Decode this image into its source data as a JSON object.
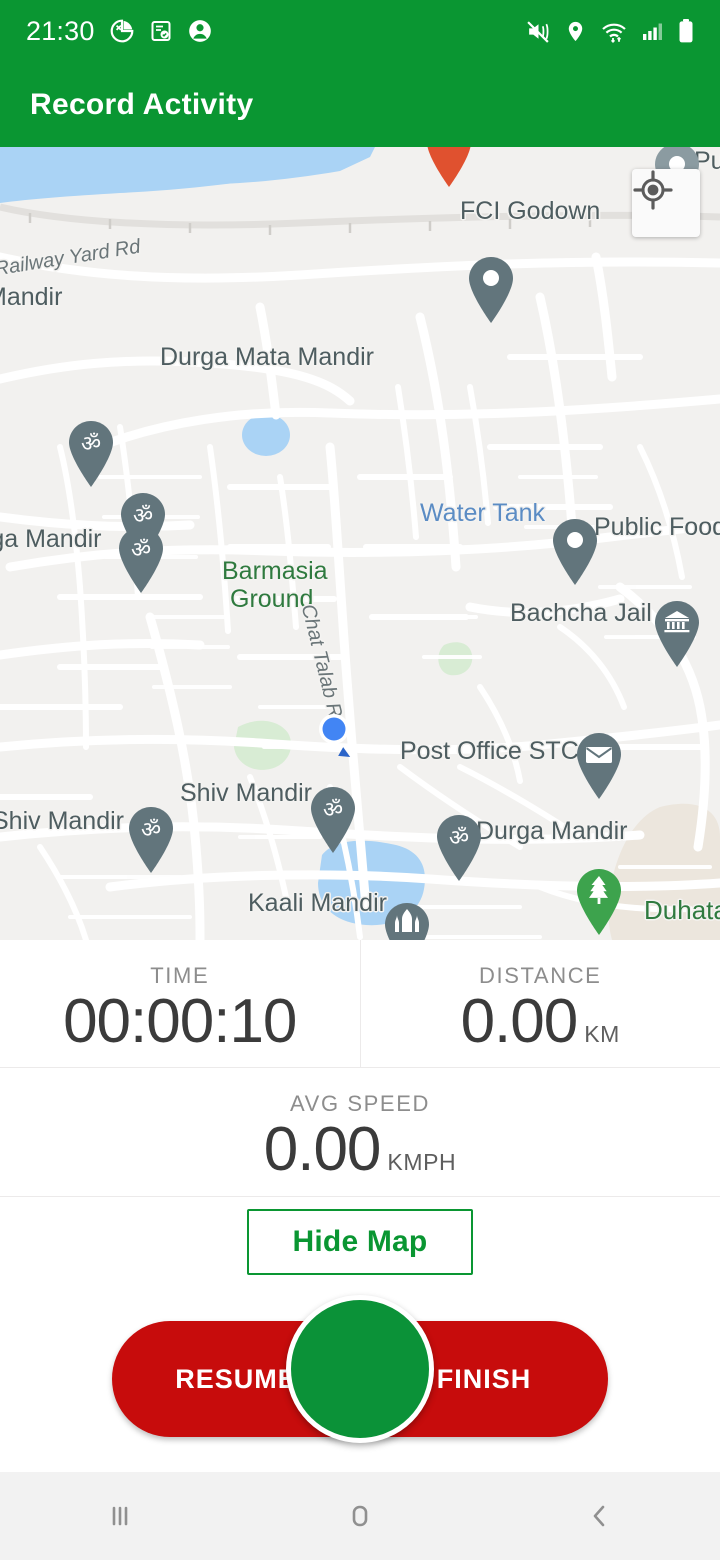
{
  "statusbar": {
    "time": "21:30",
    "left_icons": [
      "stats-pie-icon",
      "note-check-icon",
      "account-circle-icon"
    ],
    "right_icons": [
      "mute-vibrate-icon",
      "location-icon",
      "wifi-icon",
      "signal-icon",
      "battery-icon"
    ]
  },
  "appbar": {
    "title": "Record Activity"
  },
  "map": {
    "my_location_button": "my-location-icon",
    "labels": [
      {
        "text": "Railway Yard Rd",
        "kind": "road"
      },
      {
        "text": "Mandir",
        "kind": "poi"
      },
      {
        "text": "Durga Mata Mandir",
        "kind": "poi"
      },
      {
        "text": "FCI Godown",
        "kind": "poi"
      },
      {
        "text": "Pu",
        "kind": "poi"
      },
      {
        "text": "rga Mandir",
        "kind": "poi"
      },
      {
        "text": "Water Tank",
        "kind": "water"
      },
      {
        "text": "Public Food",
        "kind": "poi"
      },
      {
        "text": "Barmasia",
        "kind": "park"
      },
      {
        "text": "Ground",
        "kind": "park"
      },
      {
        "text": "Bachcha Jail",
        "kind": "poi"
      },
      {
        "text": "Chat Talab Rd",
        "kind": "road"
      },
      {
        "text": "Post Office STC",
        "kind": "poi"
      },
      {
        "text": "Shiv Mandir",
        "kind": "poi"
      },
      {
        "text": "Shiv Mandir",
        "kind": "poi"
      },
      {
        "text": "Durga Mandir",
        "kind": "poi"
      },
      {
        "text": "Kaali Mandir",
        "kind": "poi"
      },
      {
        "text": "Duhata",
        "kind": "green"
      }
    ],
    "markers": [
      {
        "name": "om-temple-pin",
        "label": "Mandir"
      },
      {
        "name": "om-temple-pin",
        "label": "Durga Mata Mandir"
      },
      {
        "name": "om-temple-pin",
        "label": "rga Mandir"
      },
      {
        "name": "om-temple-pin",
        "label": "Shiv Mandir"
      },
      {
        "name": "om-temple-pin",
        "label": "Shiv Mandir"
      },
      {
        "name": "om-temple-pin",
        "label": "Durga Mandir"
      },
      {
        "name": "generic-dot-pin",
        "label": ""
      },
      {
        "name": "generic-dot-pin",
        "label": "Public Food"
      },
      {
        "name": "generic-dot-pin",
        "label": "Pu"
      },
      {
        "name": "museum-pin",
        "label": "Bachcha Jail"
      },
      {
        "name": "post-office-pin",
        "label": "Post Office STC"
      },
      {
        "name": "temple-building-pin",
        "label": "Kaali Mandir"
      },
      {
        "name": "park-tree-pin",
        "label": "Duhata"
      },
      {
        "name": "red-destination-pin",
        "label": ""
      }
    ],
    "user_location": "user-location-dot"
  },
  "stats": {
    "time": {
      "label": "TIME",
      "value": "00:00:10",
      "unit": ""
    },
    "distance": {
      "label": "DISTANCE",
      "value": "0.00",
      "unit": "KM"
    },
    "avg_speed": {
      "label": "AVG SPEED",
      "value": "0.00",
      "unit": "KMPH"
    }
  },
  "controls": {
    "hide_map_label": "Hide Map",
    "resume_label": "RESUME",
    "finish_label": "FINISH",
    "center_button": "pause-record-button"
  },
  "navbar": {
    "recents": "recents-icon",
    "home": "home-icon",
    "back": "back-icon"
  },
  "colors": {
    "brand_green": "#0a9632",
    "danger_red": "#c70c0c",
    "map_bg": "#f2f1ef",
    "water_blue": "#aad3f5",
    "pin_gray": "#62757c"
  }
}
